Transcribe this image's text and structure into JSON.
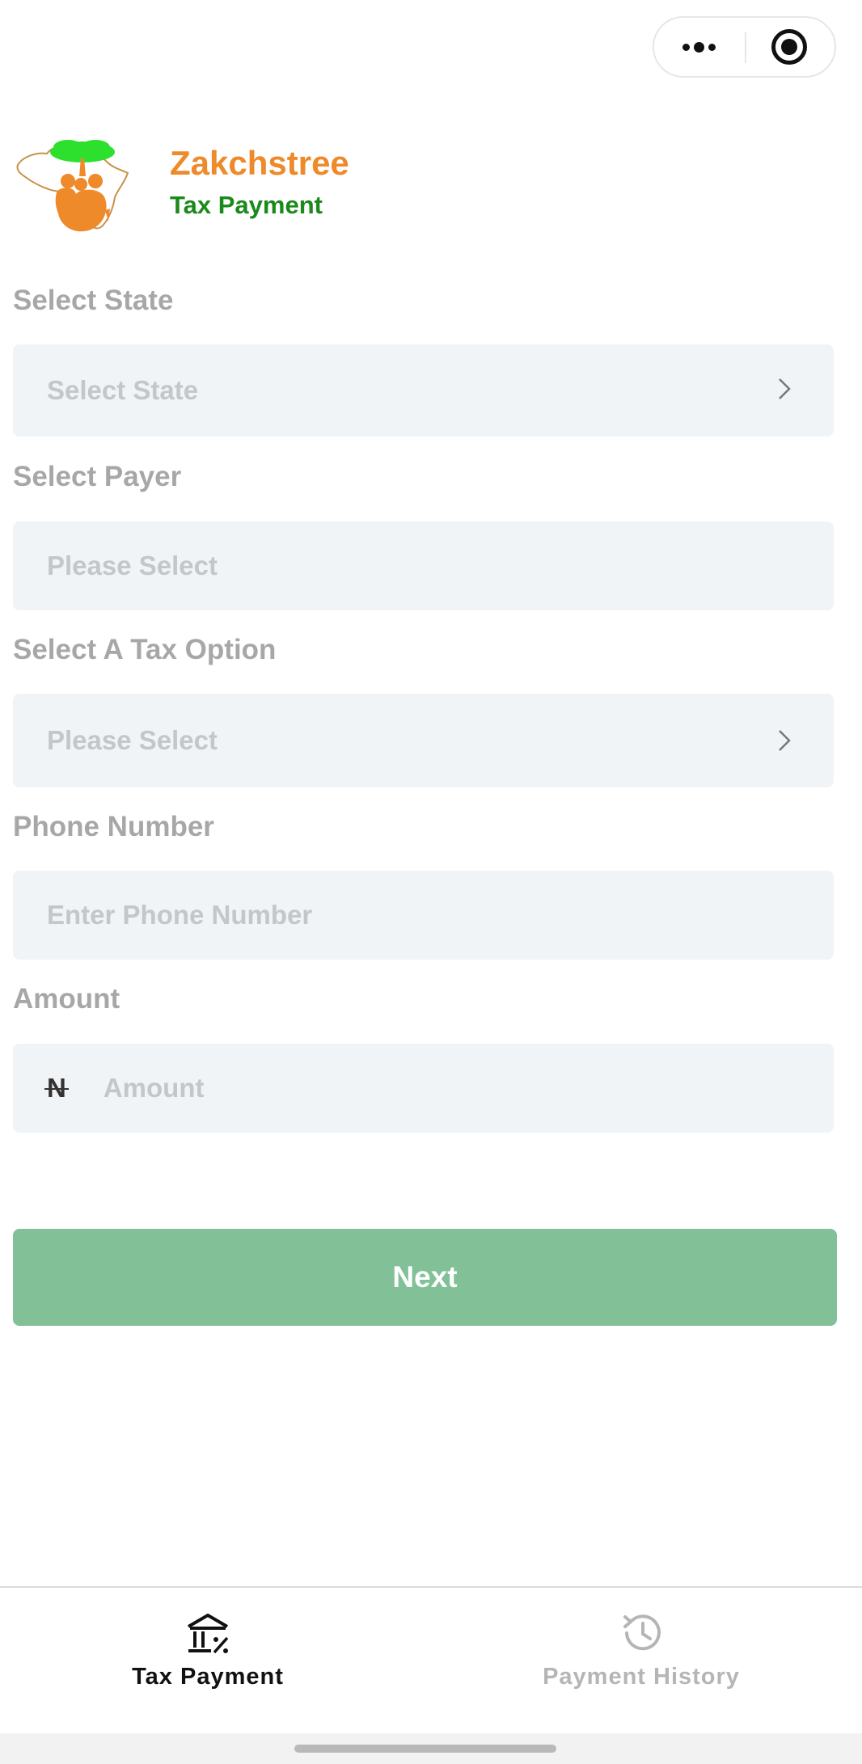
{
  "brand": {
    "name": "Zakchstree",
    "subtitle": "Tax Payment",
    "logo_icon": "africa-tree-family-logo"
  },
  "capsule": {
    "more_icon": "more-dots-icon",
    "close_icon": "target-close-icon"
  },
  "form": {
    "state": {
      "label": "Select State",
      "placeholder": "Select State"
    },
    "payer": {
      "label": "Select Payer",
      "placeholder": "Please Select"
    },
    "tax_option": {
      "label": "Select A Tax Option",
      "placeholder": "Please Select"
    },
    "phone": {
      "label": "Phone Number",
      "placeholder": "Enter Phone Number"
    },
    "amount": {
      "label": "Amount",
      "currency_symbol": "N",
      "placeholder": "Amount"
    }
  },
  "actions": {
    "next_label": "Next"
  },
  "tabbar": {
    "tabs": [
      {
        "label": "Tax Payment",
        "icon": "bank-percent-icon",
        "active": true
      },
      {
        "label": "Payment History",
        "icon": "history-clock-icon",
        "active": false
      }
    ]
  },
  "colors": {
    "brand_orange": "#ee8a2a",
    "brand_green": "#1a8a1a",
    "button_green": "#82c197",
    "field_bg": "#f0f4f7"
  }
}
